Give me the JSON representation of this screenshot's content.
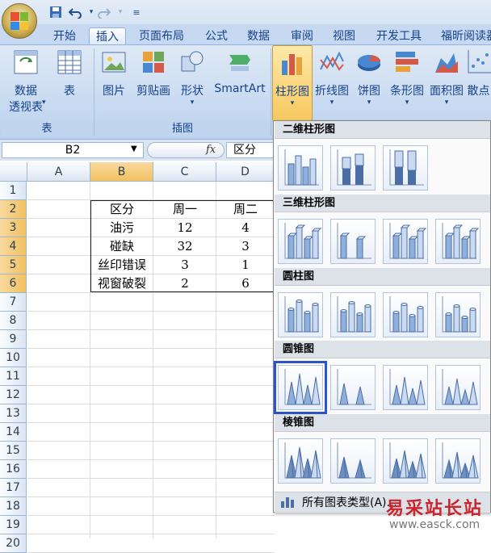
{
  "qat": {
    "save_icon": "save-icon",
    "undo_icon": "undo-icon",
    "redo_icon": "redo-icon"
  },
  "tabs": [
    "开始",
    "插入",
    "页面布局",
    "公式",
    "数据",
    "审阅",
    "视图",
    "开发工具",
    "福昕阅读器"
  ],
  "active_tab": "插入",
  "ribbon": {
    "table_group": {
      "label": "表",
      "pivot_label_1": "数据",
      "pivot_label_2": "透视表",
      "table_label": "表"
    },
    "illustrations_group": {
      "label": "插图",
      "picture": "图片",
      "clipart": "剪贴画",
      "shapes": "形状",
      "smartart": "SmartArt"
    },
    "charts_group": {
      "column": "柱形图",
      "line": "折线图",
      "pie": "饼图",
      "bar": "条形图",
      "area": "面积图",
      "scatter": "散点"
    }
  },
  "formula_bar": {
    "name_box": "B2",
    "fx": "fx",
    "value": "区分"
  },
  "columns": [
    "A",
    "B",
    "C",
    "D"
  ],
  "rows": [
    "1",
    "2",
    "3",
    "4",
    "5",
    "6",
    "7",
    "8",
    "9",
    "10",
    "11",
    "12",
    "13",
    "14",
    "15",
    "16",
    "17",
    "18",
    "19",
    "20"
  ],
  "table": {
    "header": [
      "区分",
      "周一",
      "周二"
    ],
    "rows": [
      [
        "油污",
        "12",
        "4"
      ],
      [
        "碰缺",
        "32",
        "3"
      ],
      [
        "丝印错误",
        "3",
        "1"
      ],
      [
        "视窗破裂",
        "2",
        "6"
      ]
    ]
  },
  "dropdown": {
    "sections": [
      {
        "title": "二维柱形图",
        "count": 3
      },
      {
        "title": "三维柱形图",
        "count": 4
      },
      {
        "title": "圆柱图",
        "count": 4
      },
      {
        "title": "圆锥图",
        "count": 4
      },
      {
        "title": "棱锥图",
        "count": 4
      }
    ],
    "all_types": "所有图表类型(A)...",
    "selected": "圆锥图-1"
  },
  "watermark": {
    "text": "易采站长站",
    "url": "www.easck.com"
  },
  "colors": {
    "ribbon": "#c6d9f1",
    "selection": "#2c53c8",
    "accent": "#15428b"
  }
}
